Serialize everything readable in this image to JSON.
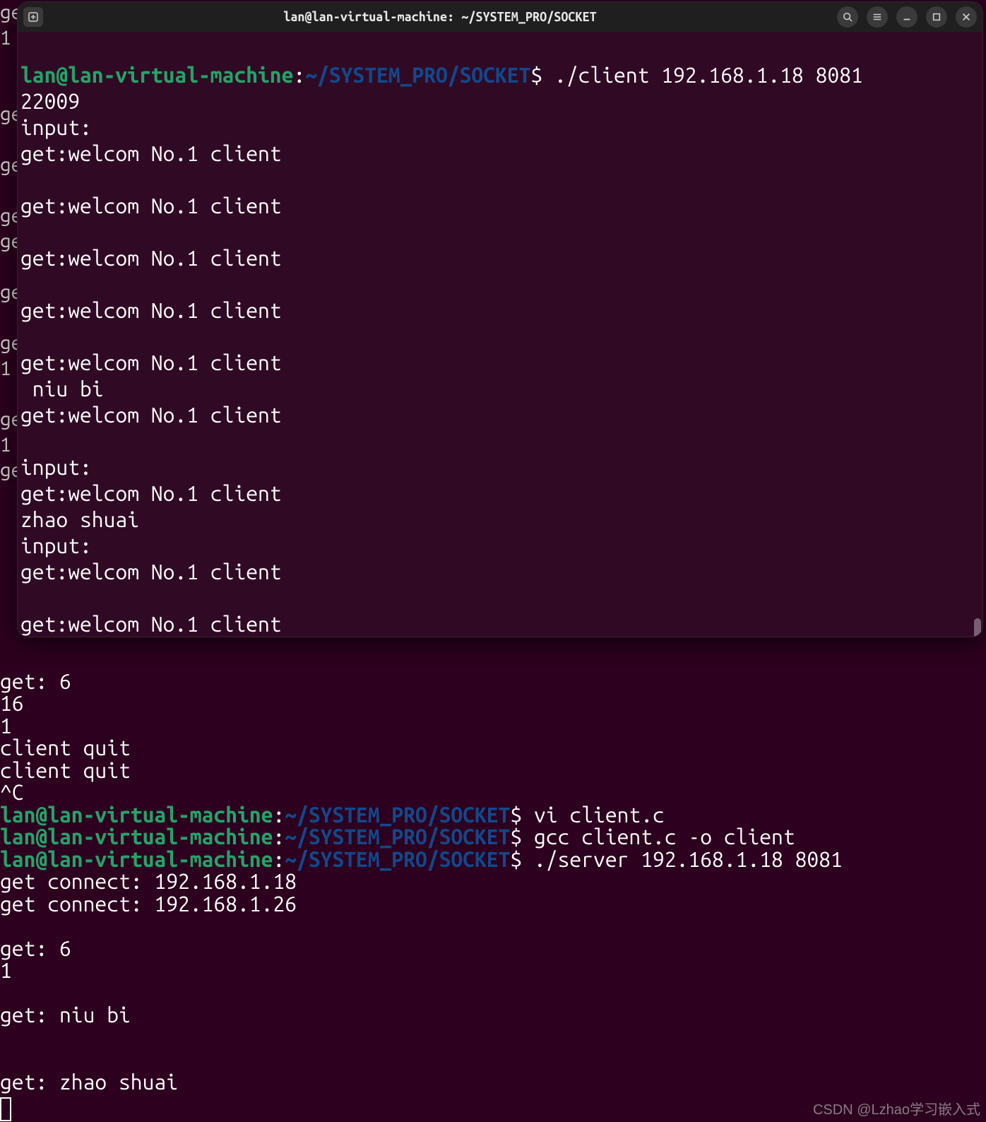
{
  "titlebar": {
    "title": "lan@lan-virtual-machine: ~/SYSTEM_PRO/SOCKET"
  },
  "bg_left": {
    "l0": "ge",
    "l1": "1",
    "l4": "ge",
    "l6": "ge",
    "l8": "ge",
    "l9": "ge",
    "l11": "ge",
    "l12": "ge",
    "l13": "1",
    "l15": "ge",
    "l16": "1",
    "l17": "ge"
  },
  "fg": {
    "user": "lan@lan-virtual-machine",
    "path": "~/SYSTEM_PRO/SOCKET",
    "cmd1": "./client 192.168.1.18 8081",
    "o0": "22009",
    "o1": "input:",
    "o2": "get:welcom No.1 client",
    "o3": "",
    "o4": "get:welcom No.1 client",
    "o5": "",
    "o6": "get:welcom No.1 client",
    "o7": "",
    "o8": "get:welcom No.1 client",
    "o9": "",
    "o10": "get:welcom No.1 client",
    "o11": " niu bi",
    "o12": "get:welcom No.1 client",
    "o13": "",
    "o14": "input:",
    "o15": "get:welcom No.1 client",
    "o16": "zhao shuai",
    "o17": "input:",
    "o18": "get:welcom No.1 client",
    "o19": "",
    "o20": "get:welcom No.1 client"
  },
  "lower": {
    "l0": "get: 6",
    "l1": "16",
    "l2": "1",
    "l3": "client quit",
    "l4": "client quit",
    "l5": "^C",
    "user": "lan@lan-virtual-machine",
    "path": "~/SYSTEM_PRO/SOCKET",
    "cmd1": "vi client.c",
    "cmd2": "gcc client.c -o client",
    "cmd3": "./server 192.168.1.18 8081",
    "o1": "get connect: 192.168.1.18",
    "o2": "get connect: 192.168.1.26",
    "o3": "",
    "o4": "get: 6",
    "o5": "1",
    "o6": "",
    "o7": "get: niu bi",
    "o8": "",
    "o9": "",
    "o10": "get: zhao shuai"
  },
  "watermark": "CSDN @Lzhao学习嵌入式"
}
